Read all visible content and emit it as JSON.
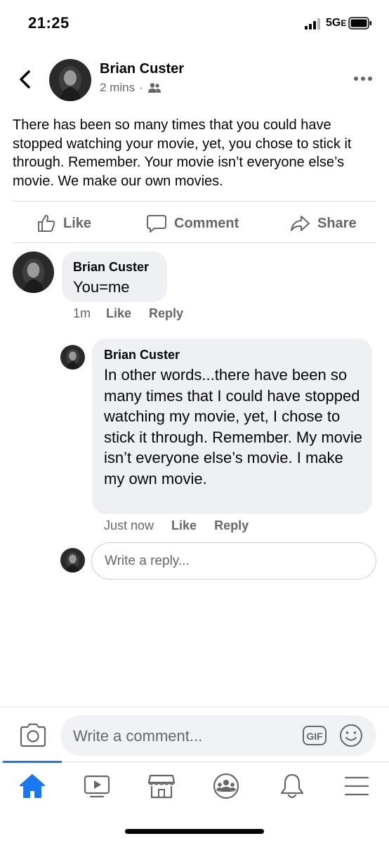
{
  "status_bar": {
    "time": "21:25",
    "network": "5G",
    "network_suffix": "E"
  },
  "post": {
    "author": "Brian Custer",
    "time": "2 mins",
    "separator": "·",
    "audience_icon": "friends-icon",
    "text": "There has been so many times that you could have stopped watching your movie, yet, you chose to stick it through. Remember. Your movie isn’t everyone else’s movie. We make our own movies."
  },
  "actions": {
    "like": "Like",
    "comment": "Comment",
    "share": "Share"
  },
  "comments": [
    {
      "author": "Brian Custer",
      "text": "You=me",
      "time": "1m",
      "like": "Like",
      "reply": "Reply"
    }
  ],
  "replies": [
    {
      "author": "Brian Custer",
      "text": "In other words...there have been so many times that I could have stopped watching my movie, yet, I chose to stick it through. Remember. My movie isn’t everyone else’s movie. I make my own movie.",
      "time": "Just now",
      "like": "Like",
      "reply": "Reply"
    }
  ],
  "reply_input": {
    "placeholder": "Write a reply..."
  },
  "composer": {
    "placeholder": "Write a comment...",
    "gif": "GIF"
  },
  "tabs": [
    {
      "icon": "home-icon",
      "active": true
    },
    {
      "icon": "watch-icon",
      "active": false
    },
    {
      "icon": "marketplace-icon",
      "active": false
    },
    {
      "icon": "groups-icon",
      "active": false
    },
    {
      "icon": "bell-icon",
      "active": false
    },
    {
      "icon": "menu-icon",
      "active": false
    }
  ],
  "colors": {
    "accent": "#1877f2",
    "text": "#050505",
    "secondary": "#65676b",
    "bubble": "#eff0f4"
  }
}
